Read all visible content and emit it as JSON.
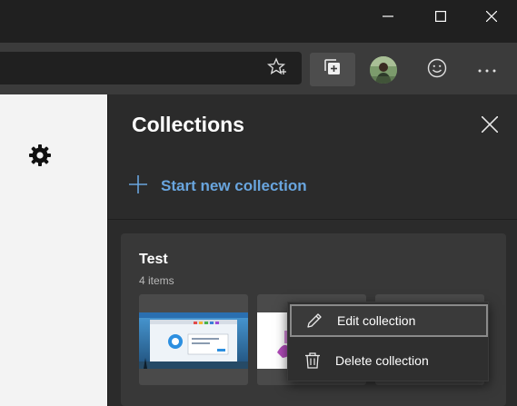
{
  "window": {
    "controls": [
      "minimize-icon",
      "maximize-icon",
      "close-icon"
    ]
  },
  "toolbar": {
    "icons": [
      "star-icon",
      "collections-icon",
      "avatar",
      "emoji-icon",
      "more-icon"
    ]
  },
  "collections": {
    "title": "Collections",
    "start_new_label": "Start new collection",
    "card": {
      "title": "Test",
      "count": "4 items"
    }
  },
  "context_menu": {
    "items": [
      {
        "label": "Edit collection",
        "icon": "pencil-icon"
      },
      {
        "label": "Delete collection",
        "icon": "trash-icon"
      }
    ]
  },
  "colors": {
    "accent": "#69a5de",
    "pane_bg": "#2b2b2b",
    "card_bg": "#383838"
  }
}
